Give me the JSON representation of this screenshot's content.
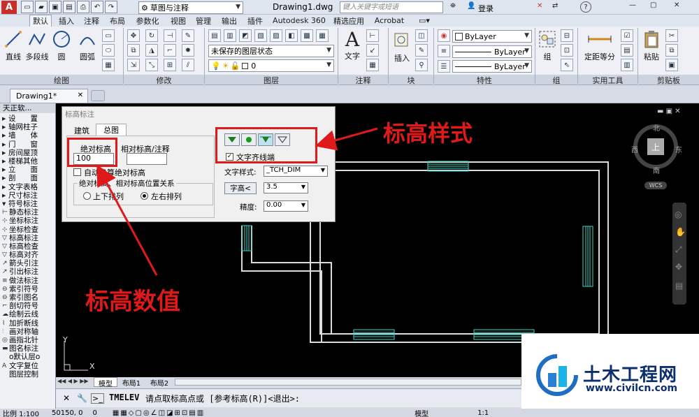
{
  "window": {
    "workspace": "草图与注释",
    "document_title": "Drawing1.dwg",
    "search_placeholder": "键入关键字或短语",
    "login": "登录"
  },
  "ribbon_tabs": [
    "默认",
    "插入",
    "注释",
    "布局",
    "参数化",
    "视图",
    "管理",
    "输出",
    "插件",
    "Autodesk 360",
    "精选应用",
    "Acrobat"
  ],
  "panels": {
    "draw": {
      "title": "绘图",
      "buttons": [
        "直线",
        "多段线",
        "圆",
        "圆弧"
      ]
    },
    "modify": {
      "title": "修改"
    },
    "layers": {
      "title": "图层",
      "state_combo": "未保存的图层状态",
      "layer_combo": "0"
    },
    "annotation": {
      "title": "注释",
      "text": "文字"
    },
    "block": {
      "title": "块",
      "insert": "插入"
    },
    "properties": {
      "title": "特性",
      "color": "ByLayer",
      "linetype": "ByLayer",
      "lineweight": "ByLayer"
    },
    "groups": {
      "title": "组",
      "group": "组"
    },
    "utilities": {
      "title": "实用工具",
      "measure": "定距等分"
    },
    "clipboard": {
      "title": "剪贴板",
      "paste": "粘贴"
    }
  },
  "doc_tab": "Drawing1*",
  "sidebar": {
    "title": "天正软...",
    "sections": [
      {
        "label": "设　　置",
        "collapsed": true
      },
      {
        "label": "轴网柱子",
        "collapsed": true
      },
      {
        "label": "墙　　体",
        "collapsed": true
      },
      {
        "label": "门　　窗",
        "collapsed": true
      },
      {
        "label": "房间屋顶",
        "collapsed": true
      },
      {
        "label": "楼梯其他",
        "collapsed": true
      },
      {
        "label": "立　　面",
        "collapsed": true
      },
      {
        "label": "剖　　面",
        "collapsed": true
      },
      {
        "label": "文字表格",
        "collapsed": true
      },
      {
        "label": "尺寸标注",
        "collapsed": true
      },
      {
        "label": "符号标注",
        "collapsed": false
      }
    ],
    "items": [
      "静态标注",
      "坐标标注",
      "坐标检查",
      "标高标注",
      "标高检查",
      "标高对齐",
      "箭头引注",
      "引出标注",
      "做法标注",
      "索引符号",
      "索引图名",
      "剖切符号",
      "绘制云线",
      "加折断线",
      "画对称轴",
      "画指北针",
      "图名标注",
      "o默认层o",
      "文字复位",
      "图层控制"
    ]
  },
  "dialog": {
    "title": "标高标注",
    "tabs": [
      "建筑",
      "总图"
    ],
    "absolute_label": "绝对标高",
    "relative_label": "相对标高/注释",
    "absolute_value": "100",
    "relative_value": "",
    "auto_convert": "自动换算绝对标高",
    "group_title": "绝对标高、相对标高位置关系",
    "radio_updown": "上下排列",
    "radio_leftright": "左右排列",
    "align_text": "文字齐线端",
    "text_style_label": "文字样式:",
    "text_style_value": "_TCH_DIM",
    "height_label": "字高<",
    "height_value": "3.5",
    "precision_label": "精度:",
    "precision_value": "0.00"
  },
  "annotations": {
    "style": "标高样式",
    "value": "标高数值"
  },
  "viewcube": {
    "north": "北",
    "south": "南",
    "west": "西",
    "east": "东",
    "top": "上",
    "wcs": "WCS"
  },
  "axes": {
    "x": "X",
    "y": "Y"
  },
  "layout_tabs": [
    "模型",
    "布局1",
    "布局2"
  ],
  "command": {
    "name": "TMELEV",
    "text": "请点取标高点或 [参考标高(R)]<退出>:"
  },
  "status": {
    "scale": "比例 1:100",
    "coords": "50150, 0",
    "zero": "0",
    "space": "模型",
    "anno_scale": "1:1"
  },
  "watermark": {
    "cn": "土木工程网",
    "url": "www.civilcn.com"
  },
  "colors": {
    "cad_background": "#000000",
    "wall_lines": "#dcdcdc",
    "window_lines": "#37d8c6",
    "annotation_red": "#e0191b",
    "ribbon_bg": "#dfe3ea"
  }
}
